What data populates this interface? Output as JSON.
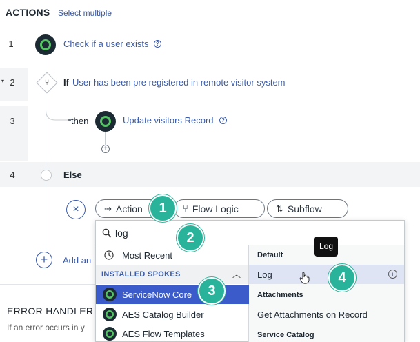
{
  "header": {
    "title": "ACTIONS",
    "select_multiple": "Select multiple"
  },
  "rows": [
    {
      "number": "1",
      "label": "Check if a user exists"
    },
    {
      "number": "2",
      "keyword": "If",
      "label": "User has been pre registered in remote visitor system"
    },
    {
      "number": "3",
      "keyword": "then",
      "label": "Update visitors Record"
    },
    {
      "number": "4",
      "keyword": "Else"
    }
  ],
  "add_label": "Add an",
  "picker": {
    "tabs": [
      {
        "label": "Action",
        "icon": "action-icon"
      },
      {
        "label": "Flow Logic",
        "icon": "flow-logic-icon"
      },
      {
        "label": "Subflow",
        "icon": "subflow-icon"
      }
    ],
    "search_value": "log",
    "most_recent": "Most Recent",
    "installed_spokes_header": "INSTALLED SPOKES",
    "spokes": [
      "ServiceNow Core",
      "AES Catalog Builder",
      "AES Flow Templates"
    ],
    "spoke_search_highlight": {
      "prefix": "AES Cata",
      "match": "log",
      "suffix": " Builder"
    },
    "right_sections": [
      {
        "header": "Default",
        "items": [
          "Log"
        ]
      },
      {
        "header": "Attachments",
        "items": [
          "Get Attachments on Record"
        ]
      },
      {
        "header": "Service Catalog",
        "items": []
      }
    ],
    "tooltip": "Log"
  },
  "badges": [
    "1",
    "2",
    "3",
    "4"
  ],
  "error_handler": {
    "title": "ERROR HANDLER",
    "text": "If an error occurs in y"
  },
  "colors": {
    "accent": "#3a5ba9",
    "badge": "#29b39a",
    "selected": "#3a5bc9",
    "hover": "#dfe4f5",
    "spoke_ring": "#56c464"
  }
}
